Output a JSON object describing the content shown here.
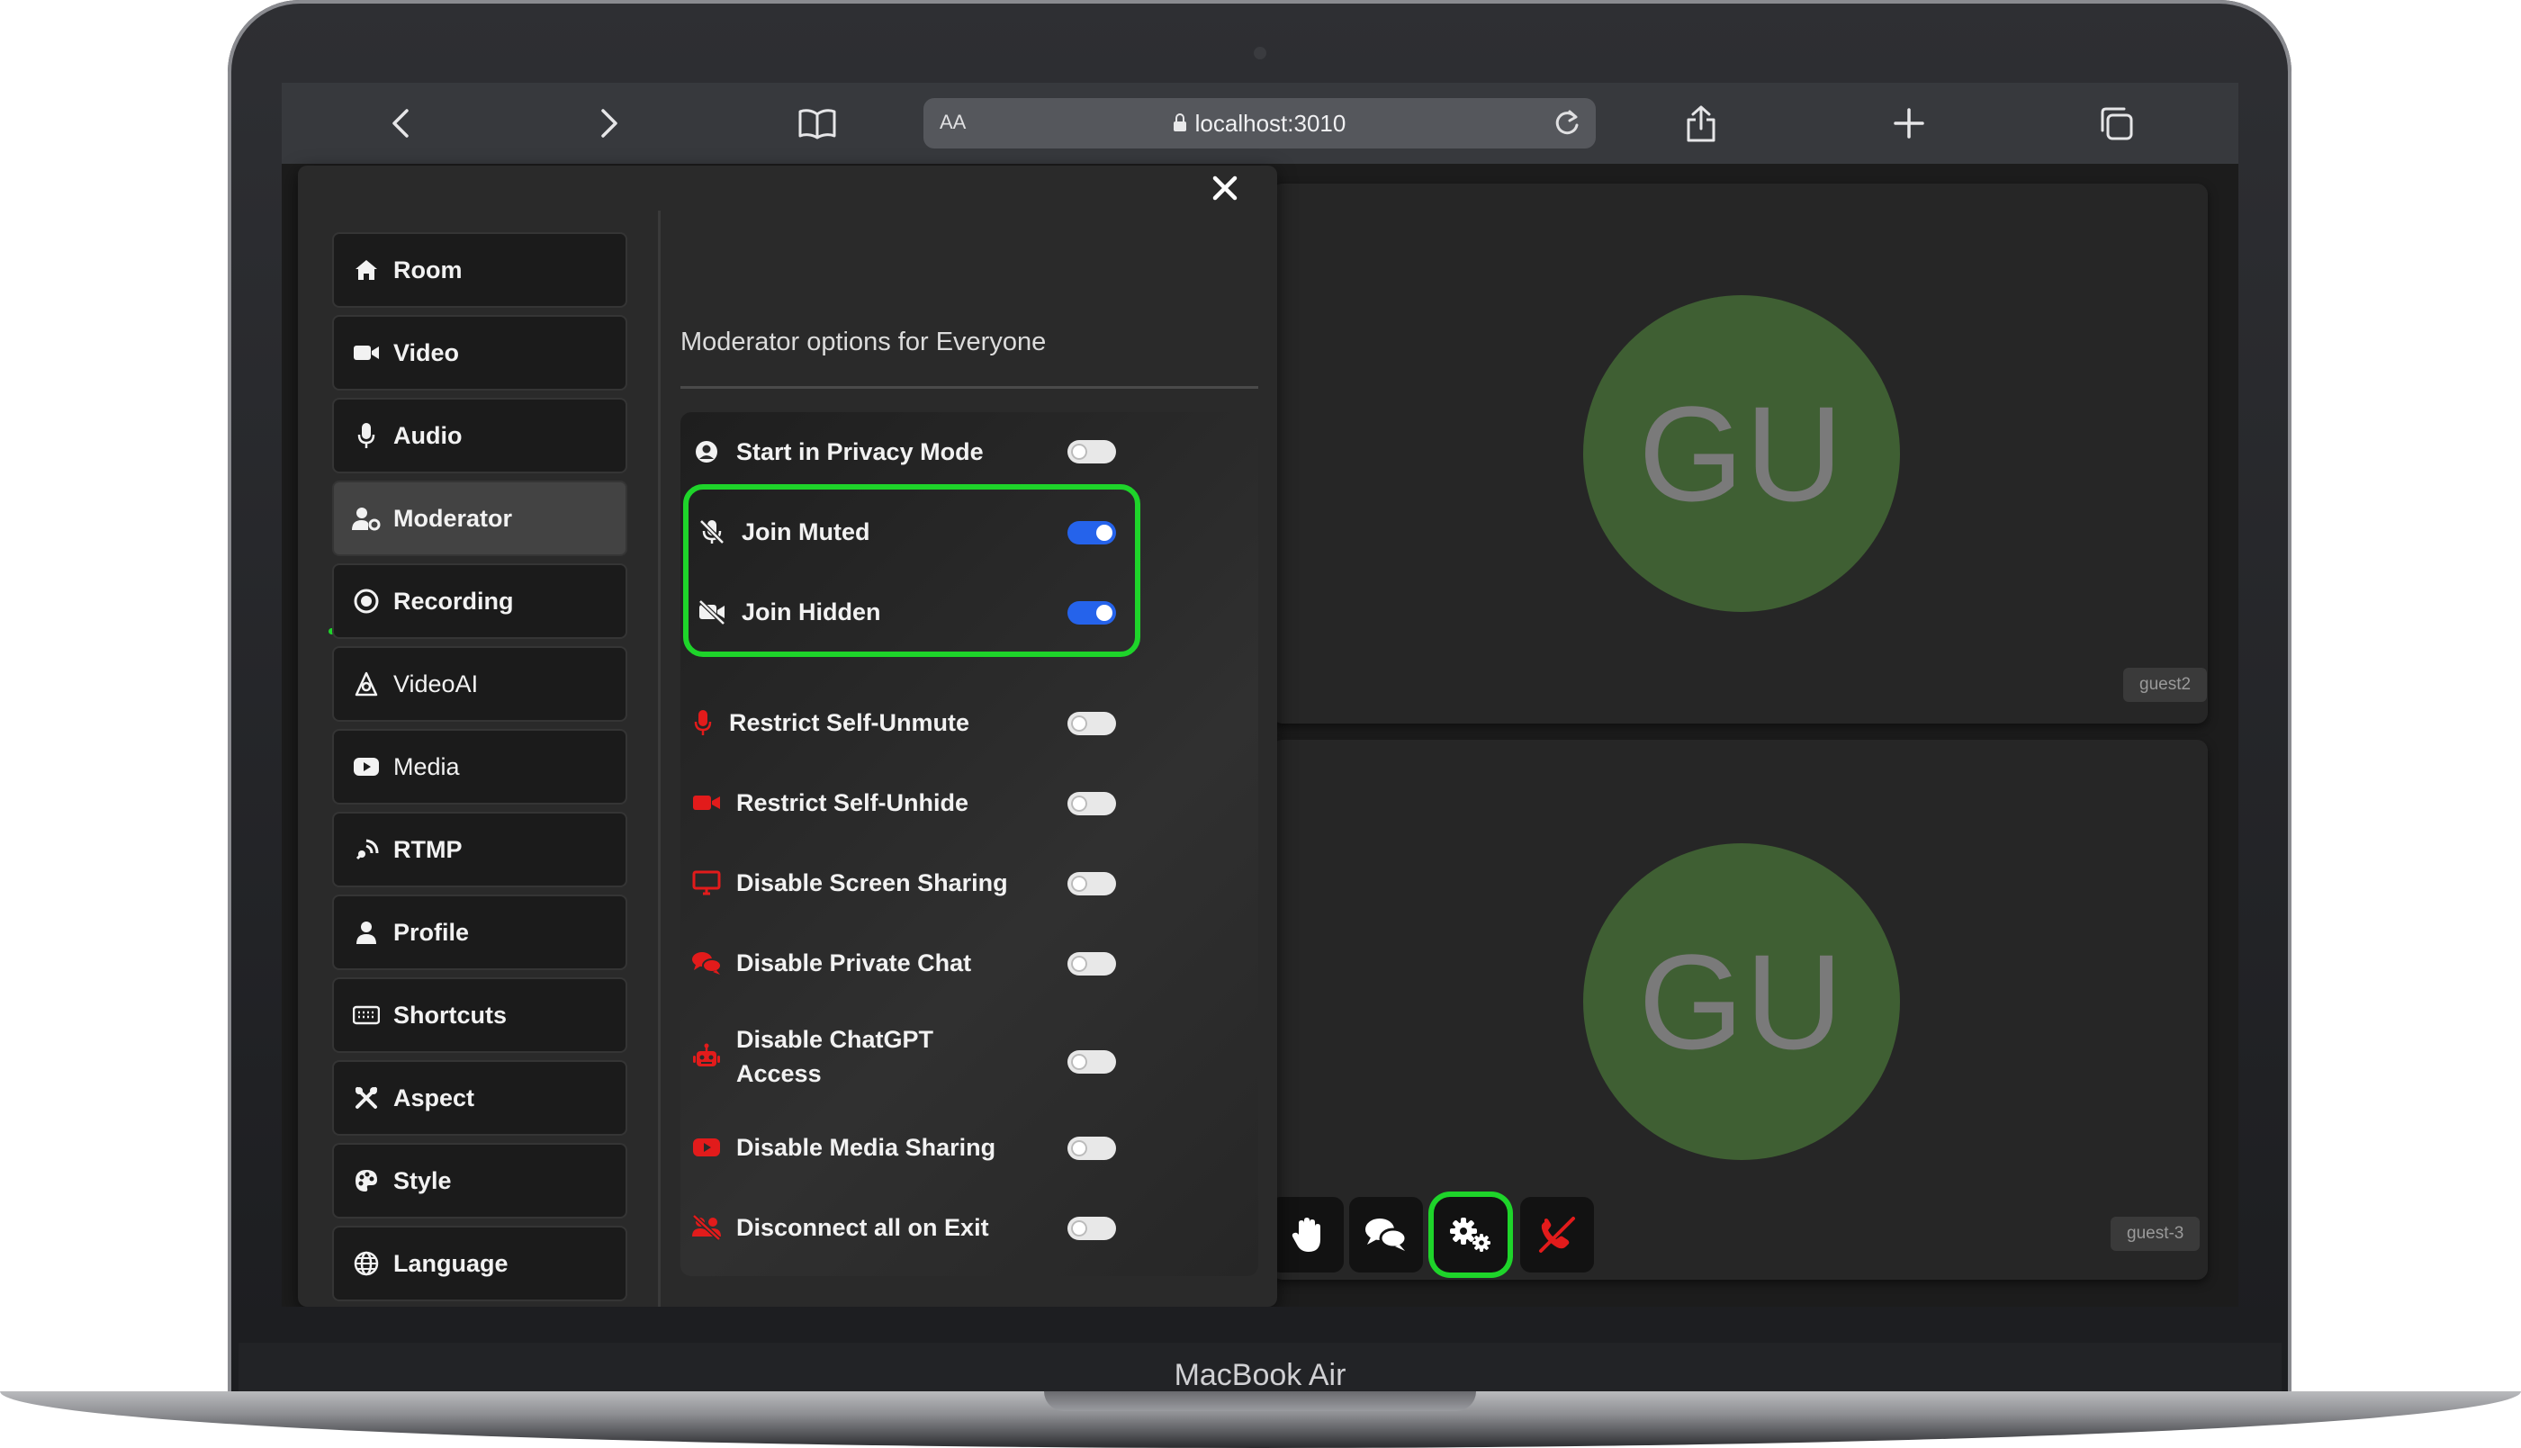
{
  "device": {
    "brand": "MacBook Air"
  },
  "browser": {
    "url_prefix": "AA",
    "url": "localhost:3010"
  },
  "tiles": [
    {
      "initials": "GU",
      "name": "guest2"
    },
    {
      "initials": "GU",
      "name": "guest-3"
    }
  ],
  "settings": {
    "nav": [
      {
        "label": "Room",
        "icon": "home-icon"
      },
      {
        "label": "Video",
        "icon": "video-camera-icon"
      },
      {
        "label": "Audio",
        "icon": "microphone-icon"
      },
      {
        "label": "Moderator",
        "icon": "user-cog-icon",
        "active": true
      },
      {
        "label": "Recording",
        "icon": "record-icon"
      },
      {
        "label": "VideoAI",
        "icon": "ai-icon"
      },
      {
        "label": "Media",
        "icon": "youtube-icon"
      },
      {
        "label": "RTMP",
        "icon": "broadcast-icon"
      },
      {
        "label": "Profile",
        "icon": "user-icon"
      },
      {
        "label": "Shortcuts",
        "icon": "keyboard-icon"
      },
      {
        "label": "Aspect",
        "icon": "tools-icon"
      },
      {
        "label": "Style",
        "icon": "palette-icon"
      },
      {
        "label": "Language",
        "icon": "globe-icon"
      }
    ],
    "title": "Moderator options for Everyone",
    "options": [
      {
        "label": "Start in Privacy Mode",
        "icon": "privacy-user-icon",
        "on": false
      },
      {
        "label": "Join Muted",
        "icon": "microphone-slash-icon",
        "on": true
      },
      {
        "label": "Join Hidden",
        "icon": "video-slash-icon",
        "on": true
      },
      {
        "label": "Restrict Self-Unmute",
        "icon": "microphone-icon",
        "on": false
      },
      {
        "label": "Restrict Self-Unhide",
        "icon": "video-camera-icon",
        "on": false
      },
      {
        "label": "Disable Screen Sharing",
        "icon": "desktop-icon",
        "on": false
      },
      {
        "label": "Disable Private Chat",
        "icon": "comments-icon",
        "on": false
      },
      {
        "label": "Disable ChatGPT Access",
        "icon": "robot-icon",
        "on": false
      },
      {
        "label": "Disable Media Sharing",
        "icon": "youtube-icon",
        "on": false
      },
      {
        "label": "Disconnect all on Exit",
        "icon": "users-slash-icon",
        "on": false
      }
    ]
  },
  "colors": {
    "highlight": "#1ed42a",
    "toggle_on": "#2563eb",
    "danger_icon": "#e21b1b",
    "avatar_bg": "#3f5f33"
  }
}
